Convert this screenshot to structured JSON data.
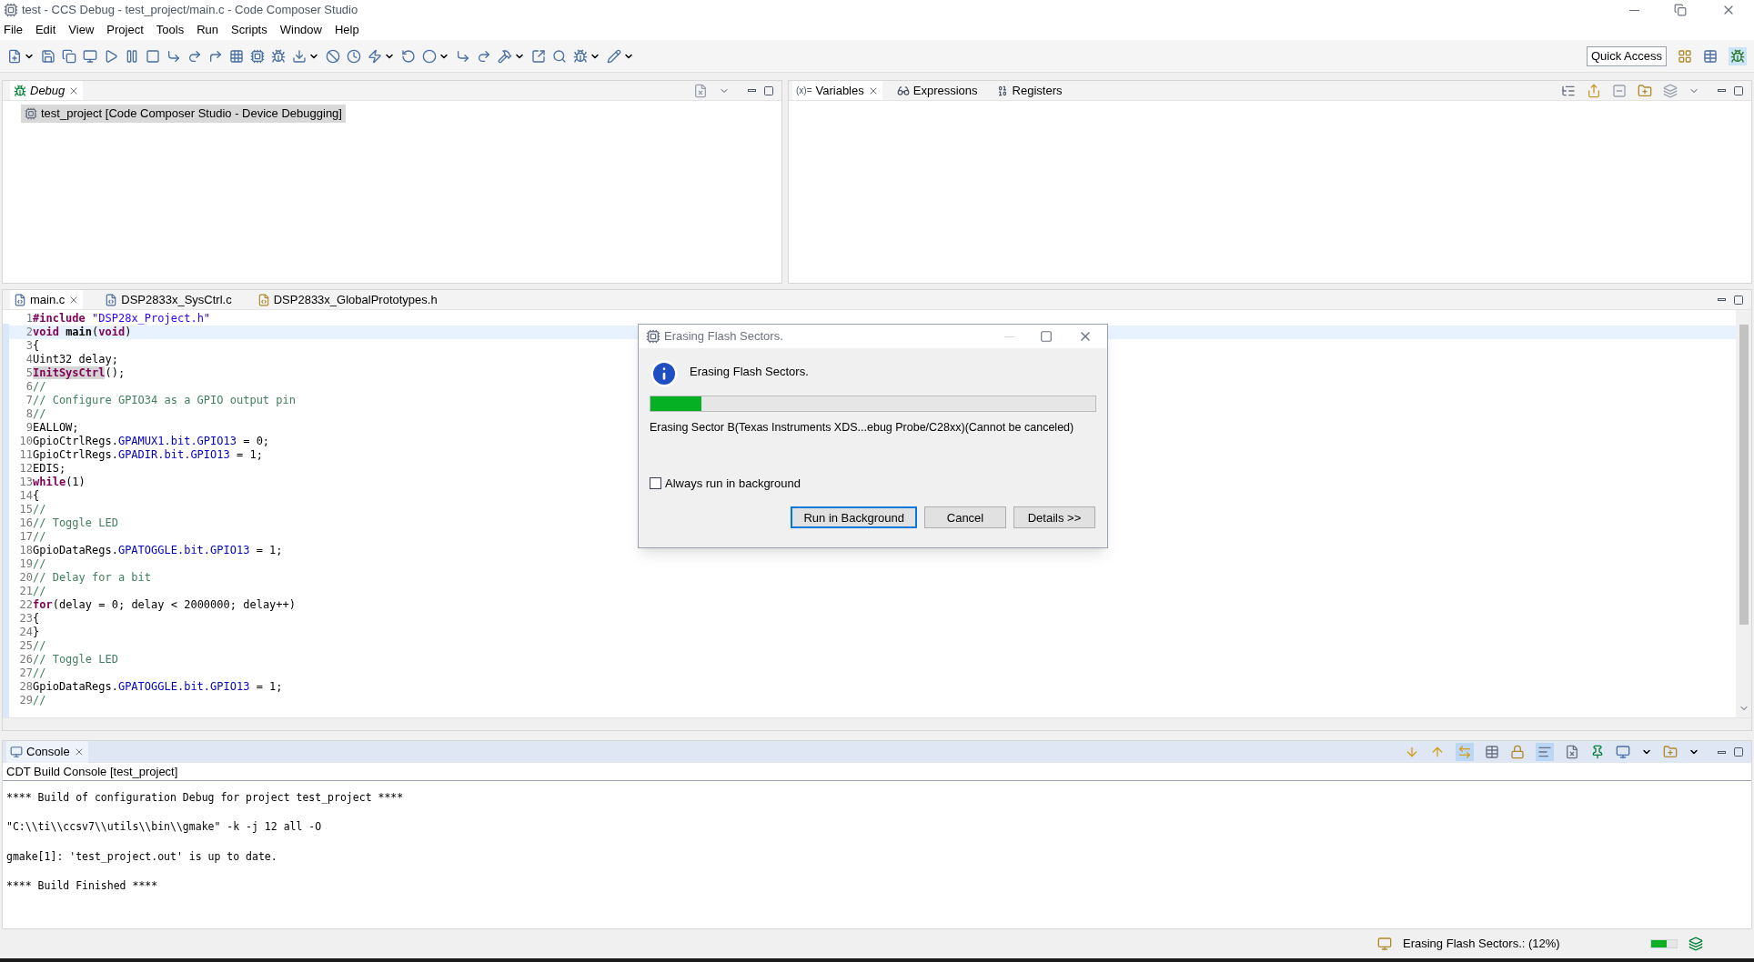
{
  "window": {
    "title": "test - CCS Debug - test_project/main.c - Code Composer Studio"
  },
  "menu": [
    "File",
    "Edit",
    "View",
    "Project",
    "Tools",
    "Run",
    "Scripts",
    "Window",
    "Help"
  ],
  "quick_access": {
    "label": "Quick Access"
  },
  "debug_view": {
    "tabs": [
      {
        "label": "Debug",
        "selected": true
      }
    ],
    "tree": [
      {
        "label": "test_project [Code Composer Studio - Device Debugging]",
        "selected": true
      }
    ]
  },
  "variables_view": {
    "tabs": [
      {
        "label": "Variables",
        "icon_text": "(x)=",
        "selected": true
      },
      {
        "label": "Expressions",
        "selected": false
      },
      {
        "label": "Registers",
        "selected": false
      }
    ]
  },
  "editor": {
    "tabs": [
      {
        "label": "main.c",
        "selected": true,
        "kind": "c"
      },
      {
        "label": "DSP2833x_SysCtrl.c",
        "selected": false,
        "kind": "c"
      },
      {
        "label": "DSP2833x_GlobalPrototypes.h",
        "selected": false,
        "kind": "h"
      }
    ],
    "lines": [
      {
        "n": "1",
        "current": false,
        "segments": [
          {
            "kind": "kw",
            "text": "#include "
          },
          {
            "kind": "str",
            "text": "\"DSP28x_Project.h\""
          }
        ]
      },
      {
        "n": "2",
        "current": true,
        "segments": [
          {
            "kind": "kw",
            "text": "void "
          },
          {
            "kind": "fn",
            "text": "main"
          },
          {
            "kind": "plain",
            "text": "("
          },
          {
            "kind": "kw",
            "text": "void"
          },
          {
            "kind": "plain",
            "text": ")"
          }
        ]
      },
      {
        "n": "3",
        "current": false,
        "segments": [
          {
            "kind": "plain",
            "text": "{"
          }
        ]
      },
      {
        "n": "4",
        "current": false,
        "segments": [
          {
            "kind": "plain",
            "text": "Uint32 delay;"
          }
        ]
      },
      {
        "n": "5",
        "current": false,
        "segments": [
          {
            "kind": "mark",
            "text": "InitSysCtrl"
          },
          {
            "kind": "plain",
            "text": "();"
          }
        ]
      },
      {
        "n": "6",
        "current": false,
        "segments": [
          {
            "kind": "comment",
            "text": "//"
          }
        ]
      },
      {
        "n": "7",
        "current": false,
        "segments": [
          {
            "kind": "comment",
            "text": "// Configure GPIO34 as a GPIO output pin"
          }
        ]
      },
      {
        "n": "8",
        "current": false,
        "segments": [
          {
            "kind": "comment",
            "text": "//"
          }
        ]
      },
      {
        "n": "9",
        "current": false,
        "segments": [
          {
            "kind": "plain",
            "text": "EALLOW;"
          }
        ]
      },
      {
        "n": "10",
        "current": false,
        "segments": [
          {
            "kind": "plain",
            "text": "GpioCtrlRegs."
          },
          {
            "kind": "field",
            "text": "GPAMUX1.bit.GPIO13"
          },
          {
            "kind": "plain",
            "text": " = 0;"
          }
        ]
      },
      {
        "n": "11",
        "current": false,
        "segments": [
          {
            "kind": "plain",
            "text": "GpioCtrlRegs."
          },
          {
            "kind": "field",
            "text": "GPADIR.bit.GPIO13"
          },
          {
            "kind": "plain",
            "text": " = 1;"
          }
        ]
      },
      {
        "n": "12",
        "current": false,
        "segments": [
          {
            "kind": "plain",
            "text": "EDIS;"
          }
        ]
      },
      {
        "n": "13",
        "current": false,
        "segments": [
          {
            "kind": "kw",
            "text": "while"
          },
          {
            "kind": "plain",
            "text": "(1)"
          }
        ]
      },
      {
        "n": "14",
        "current": false,
        "segments": [
          {
            "kind": "plain",
            "text": "{"
          }
        ]
      },
      {
        "n": "15",
        "current": false,
        "segments": [
          {
            "kind": "comment",
            "text": "//"
          }
        ]
      },
      {
        "n": "16",
        "current": false,
        "segments": [
          {
            "kind": "comment",
            "text": "// Toggle LED"
          }
        ]
      },
      {
        "n": "17",
        "current": false,
        "segments": [
          {
            "kind": "comment",
            "text": "//"
          }
        ]
      },
      {
        "n": "18",
        "current": false,
        "segments": [
          {
            "kind": "plain",
            "text": "GpioDataRegs."
          },
          {
            "kind": "field",
            "text": "GPATOGGLE.bit.GPIO13"
          },
          {
            "kind": "plain",
            "text": " = 1;"
          }
        ]
      },
      {
        "n": "19",
        "current": false,
        "segments": [
          {
            "kind": "comment",
            "text": "//"
          }
        ]
      },
      {
        "n": "20",
        "current": false,
        "segments": [
          {
            "kind": "comment",
            "text": "// Delay for a bit"
          }
        ]
      },
      {
        "n": "21",
        "current": false,
        "segments": [
          {
            "kind": "comment",
            "text": "//"
          }
        ]
      },
      {
        "n": "22",
        "current": false,
        "segments": [
          {
            "kind": "kw",
            "text": "for"
          },
          {
            "kind": "plain",
            "text": "(delay = 0; delay < 2000000; delay++)"
          }
        ]
      },
      {
        "n": "23",
        "current": false,
        "segments": [
          {
            "kind": "plain",
            "text": "{"
          }
        ]
      },
      {
        "n": "24",
        "current": false,
        "segments": [
          {
            "kind": "plain",
            "text": "}"
          }
        ]
      },
      {
        "n": "25",
        "current": false,
        "segments": [
          {
            "kind": "comment",
            "text": "//"
          }
        ]
      },
      {
        "n": "26",
        "current": false,
        "segments": [
          {
            "kind": "comment",
            "text": "// Toggle LED"
          }
        ]
      },
      {
        "n": "27",
        "current": false,
        "segments": [
          {
            "kind": "comment",
            "text": "//"
          }
        ]
      },
      {
        "n": "28",
        "current": false,
        "segments": [
          {
            "kind": "plain",
            "text": "GpioDataRegs."
          },
          {
            "kind": "field",
            "text": "GPATOGGLE.bit.GPIO13"
          },
          {
            "kind": "plain",
            "text": " = 1;"
          }
        ]
      },
      {
        "n": "29",
        "current": false,
        "segments": [
          {
            "kind": "comment",
            "text": "//"
          }
        ]
      }
    ]
  },
  "console": {
    "tabs": [
      {
        "label": "Console",
        "selected": true
      }
    ],
    "subtitle": "CDT Build Console [test_project]",
    "lines": [
      "**** Build of configuration Debug for project test_project ****",
      "\"C:\\\\ti\\\\ccsv7\\\\utils\\\\bin\\\\gmake\" -k -j 12 all -O",
      "gmake[1]: 'test_project.out' is up to date.",
      "**** Build Finished ****"
    ]
  },
  "status_bar": {
    "message": "Erasing Flash Sectors.: (12%)",
    "level": 0.6
  },
  "dialog": {
    "title": "Erasing Flash Sectors.",
    "message": "Erasing Flash Sectors.",
    "level": 0.115,
    "detail": "Erasing Sector B(Texas Instruments XDS...ebug Probe/C28xx)(Cannot be canceled)",
    "checkbox": {
      "label": "Always run in background",
      "checked": false
    },
    "buttons": [
      {
        "label": "Run in Background",
        "selected": true
      },
      {
        "label": "Cancel",
        "selected": false
      },
      {
        "label": "Details >>",
        "selected": false
      }
    ]
  }
}
